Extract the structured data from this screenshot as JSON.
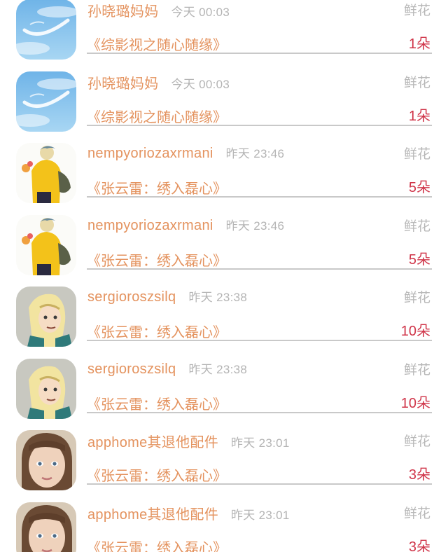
{
  "rows": [
    {
      "user": "孙晓璐妈妈",
      "time": "今天 00:03",
      "gift_type": "鲜花",
      "work": "《综影视之随心随缘》",
      "count": "1朵",
      "avatar_icon": "sky-avatar-icon"
    },
    {
      "user": "孙晓璐妈妈",
      "time": "今天 00:03",
      "gift_type": "鲜花",
      "work": "《综影视之随心随缘》",
      "count": "1朵",
      "avatar_icon": "sky-avatar-icon"
    },
    {
      "user": "nempyoriozaxrmani",
      "time": "昨天 23:46",
      "gift_type": "鲜花",
      "work": "《张云雷：绣入磊心》",
      "count": "5朵",
      "avatar_icon": "yellow-jacket-avatar-icon"
    },
    {
      "user": "nempyoriozaxrmani",
      "time": "昨天 23:46",
      "gift_type": "鲜花",
      "work": "《张云雷：绣入磊心》",
      "count": "5朵",
      "avatar_icon": "yellow-jacket-avatar-icon"
    },
    {
      "user": "sergioroszsilq",
      "time": "昨天 23:38",
      "gift_type": "鲜花",
      "work": "《张云雷：绣入磊心》",
      "count": "10朵",
      "avatar_icon": "anime-character-avatar-icon"
    },
    {
      "user": "sergioroszsilq",
      "time": "昨天 23:38",
      "gift_type": "鲜花",
      "work": "《张云雷：绣入磊心》",
      "count": "10朵",
      "avatar_icon": "anime-character-avatar-icon"
    },
    {
      "user": "apphome其退他配件",
      "time": "昨天 23:01",
      "gift_type": "鲜花",
      "work": "《张云雷：绣入磊心》",
      "count": "3朵",
      "avatar_icon": "child-photo-avatar-icon"
    },
    {
      "user": "apphome其退他配件",
      "time": "昨天 23:01",
      "gift_type": "鲜花",
      "work": "《张云雷：绣入磊心》",
      "count": "3朵",
      "avatar_icon": "child-photo-avatar-icon"
    }
  ],
  "colors": {
    "name": "#e4935f",
    "time": "#b4b4b4",
    "gift_type": "#b8b8b8",
    "count": "#d0364a",
    "divider": "#c9c9c9"
  }
}
